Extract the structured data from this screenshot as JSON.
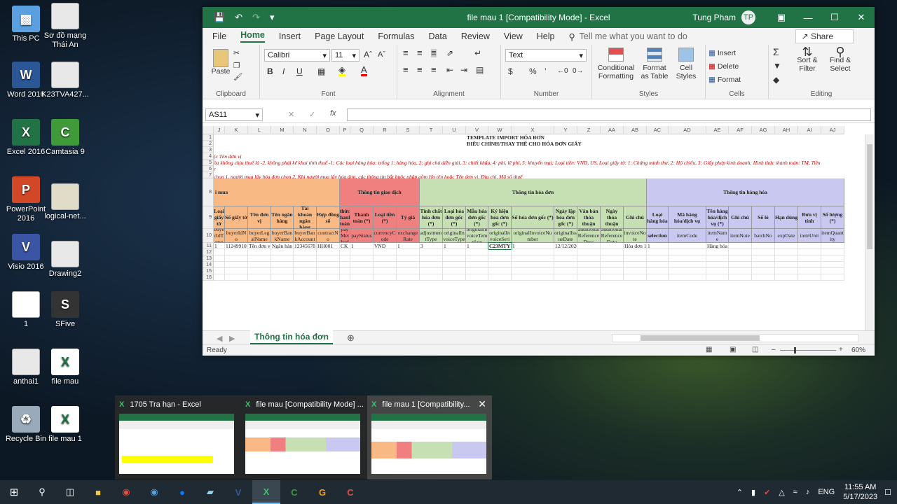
{
  "desktop_icons": [
    {
      "label": "This PC",
      "icon": "computer-icon",
      "color": "#5aa0e0"
    },
    {
      "label": "Sơ đồ mạng Thái An",
      "icon": "document-thumbnail",
      "color": "#e8e8e8"
    },
    {
      "label": "Word 2016",
      "icon": "word-icon",
      "color": "#2b5797"
    },
    {
      "label": "K23TVA427...",
      "icon": "document-thumbnail",
      "color": "#e8e8e8"
    },
    {
      "label": "Excel 2016",
      "icon": "excel-icon",
      "color": "#217346"
    },
    {
      "label": "Camtasia 9",
      "icon": "camtasia-icon",
      "color": "#3f9b3a"
    },
    {
      "label": "PowerPoint 2016",
      "icon": "powerpoint-icon",
      "color": "#d24726"
    },
    {
      "label": "logical-net...",
      "icon": "document-thumbnail",
      "color": "#e0dcc8"
    },
    {
      "label": "Visio 2016",
      "icon": "visio-icon",
      "color": "#3955a3"
    },
    {
      "label": "Drawing2",
      "icon": "visio-document-icon",
      "color": "#e8e8e8"
    },
    {
      "label": "1",
      "icon": "document-thumbnail",
      "color": "#ffffff"
    },
    {
      "label": "SFive",
      "icon": "sfive-icon",
      "color": "#333333"
    },
    {
      "label": "anthai1",
      "icon": "visio-document-icon",
      "color": "#e8e8e8"
    },
    {
      "label": "file mau",
      "icon": "excel-file-icon",
      "color": "#217346"
    },
    {
      "label": "Recycle Bin",
      "icon": "recycle-bin-icon",
      "color": "#9ab"
    },
    {
      "label": "file mau 1",
      "icon": "excel-file-icon",
      "color": "#217346"
    }
  ],
  "window": {
    "title": "file mau 1  [Compatibility Mode]  -  Excel",
    "user": "Tung Pham",
    "avatar": "TP",
    "menu": [
      "File",
      "Home",
      "Insert",
      "Page Layout",
      "Formulas",
      "Data",
      "Review",
      "View",
      "Help"
    ],
    "tell_me": "Tell me what you want to do",
    "share": "Share",
    "ribbon": {
      "clipboard": {
        "label": "Clipboard",
        "paste": "Paste"
      },
      "font": {
        "label": "Font",
        "name": "Calibri",
        "size": "11",
        "bold": "B",
        "italic": "I",
        "underline": "U"
      },
      "alignment": {
        "label": "Alignment"
      },
      "number": {
        "label": "Number",
        "format": "Text",
        "currency": "$",
        "percent": "%"
      },
      "styles": {
        "label": "Styles",
        "cond": "Conditional Formatting",
        "table": "Format as Table",
        "cell": "Cell Styles"
      },
      "cells": {
        "label": "Cells",
        "insert": "Insert",
        "delete": "Delete",
        "format": "Format"
      },
      "editing": {
        "label": "Editing",
        "sort": "Sort & Filter",
        "find": "Find & Select"
      }
    },
    "name_box": "AS11",
    "fx": "fx",
    "columns": [
      "J",
      "K",
      "L",
      "M",
      "N",
      "O",
      "P",
      "Q",
      "R",
      "S",
      "T",
      "U",
      "V",
      "W",
      "X",
      "Y",
      "Z",
      "AA",
      "AB",
      "AC",
      "AD",
      "AE",
      "AF",
      "AG",
      "AH",
      "AI",
      "AJ"
    ],
    "rows": [
      "1",
      "2",
      "3",
      "4",
      "5",
      "6",
      "7",
      "8",
      "9",
      "10",
      "11",
      "12",
      "13",
      "14",
      "15",
      "16"
    ],
    "title1": "TEMPLATE IMPORT HÓA ĐƠN",
    "title2": "ĐIỀU CHỈNH/THAY THẾ CHO HÓA ĐƠN GIẤY",
    "note3": "(c Tên đơn vị",
    "note4": "ồa không chịu thuế là -2, không phải kê khai tính thuế -1; Các loại hàng hóa: trống 1: hàng hóa, 2: ghi chú diễn giải, 3: chiết khấu, 4: phí, lệ phí, 5: khuyến mại; Loại tiền: VND, US, Loại giấy tờ: 1: Chứng minh thư, 2: Hộ chiếu, 3: Giấy phép kinh doanh; Hình thức thanh toán: TM, Tiền",
    "note5": "r",
    "note6": "chọn 1, người mua lấy hóa đơn chọn 2. Khi người mua lấy hóa đơn, các thông tin bắt buộc nhập gồm Họ tên hoặc Tên đơn vị, Địa chỉ, Mã số thuế",
    "groups": [
      "i mua",
      "Thông tin giao dịch",
      "Thông tin hóa đơn",
      "Thông tin hàng hóa"
    ],
    "headers": [
      "Loại giấy tờ",
      "Số giấy tờ",
      "Tên đơn vị",
      "Tên ngân hàng",
      "Tài khoản ngân hàng",
      "Hợp đồng số",
      "Hình thức thanh toán (*)",
      "Thanh toán (*)",
      "Loại tiền (*)",
      "Tỷ giá",
      "Tính chất hóa đơn (*)",
      "Loại hóa đơn gốc (*)",
      "Mẫu hóa đơn gốc (*)",
      "Ký hiệu hóa đơn gốc (*)",
      "Số hóa đơn gốc (*)",
      "Ngày lập hóa đơn gốc (*)",
      "Văn bản thỏa thuận",
      "Ngày thỏa thuận",
      "Ghi chú",
      "Loại hàng hóa",
      "Mã hàng hóa/dịch vụ",
      "Tên hàng hóa/dịch vụ (*)",
      "Ghi chú",
      "Số lô",
      "Hạn dùng",
      "Đơn vị tính",
      "Số lượng (*)"
    ],
    "codes": [
      "buyerIdType",
      "buyerIdNo",
      "buyerLegalName",
      "buyerBankName",
      "buyerBankAccount",
      "contractNo",
      "payMethod",
      "payStatus",
      "currencyCode",
      "exchangeRate",
      "adjustmentType",
      "originalInvoiceType",
      "originalInvoiceTemplate",
      "originalInvoiceSeri",
      "originalInvoiceNumber",
      "originalIssueDate",
      "additionalReferenceDesc",
      "additionalReferenceDate",
      "invoiceNote",
      "selection",
      "itemCode",
      "itemName",
      "itemNote",
      "batchNo",
      "expDate",
      "itemUnit",
      "itemQuantity"
    ],
    "row11": [
      "1",
      "11249910",
      "Tên đơn vị",
      "Ngân hàn",
      "12345678",
      "HH001",
      "CK",
      "1",
      "VND",
      "1",
      "3",
      "1",
      "1",
      "C23MTY",
      "1",
      "12/12/2020",
      "",
      "",
      "Hóa đơn 1",
      "1",
      "",
      "Hàng hóa 1",
      "",
      "",
      "",
      "",
      ""
    ],
    "sheet_tab": "Thông tin hóa đơn",
    "status": "Ready",
    "zoom": "60%"
  },
  "switcher": [
    {
      "title": "1705 Tra hạn - Excel"
    },
    {
      "title": "file mau  [Compatibility Mode] ..."
    },
    {
      "title": "file mau 1  [Compatibility..."
    }
  ],
  "taskbar": {
    "lang": "ENG",
    "time": "11:55 AM",
    "date": "5/17/2023"
  }
}
